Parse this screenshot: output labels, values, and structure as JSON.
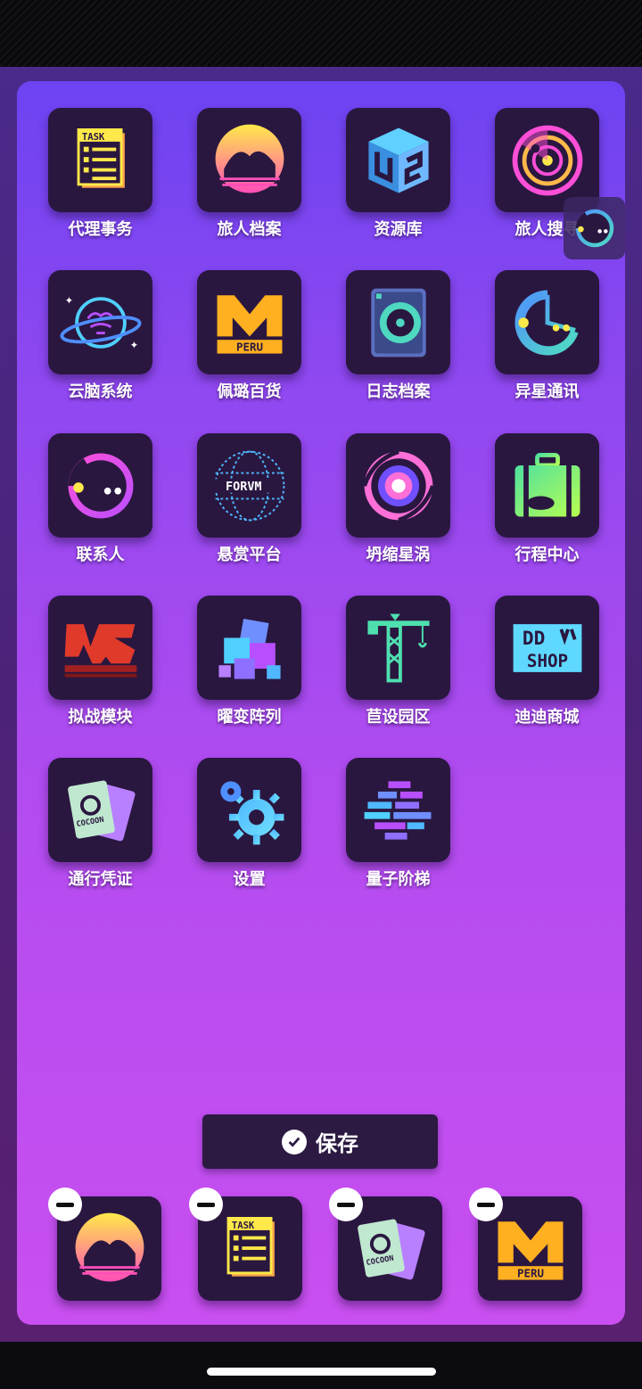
{
  "apps": [
    {
      "label": "代理事务",
      "icon": "task-list-icon"
    },
    {
      "label": "旅人档案",
      "icon": "leaper-archives-icon"
    },
    {
      "label": "资源库",
      "icon": "resource-cube-icon"
    },
    {
      "label": "旅人搜寻",
      "icon": "radar-icon"
    },
    {
      "label": "云脑系统",
      "icon": "cloud-brain-planet-icon"
    },
    {
      "label": "佩璐百货",
      "icon": "peru-logo-icon"
    },
    {
      "label": "日志档案",
      "icon": "disc-drive-icon"
    },
    {
      "label": "异星通讯",
      "icon": "chat-pacman-icon"
    },
    {
      "label": "联系人",
      "icon": "contacts-pacman-icon"
    },
    {
      "label": "悬赏平台",
      "icon": "forum-globe-icon"
    },
    {
      "label": "坍缩星涡",
      "icon": "vortex-icon"
    },
    {
      "label": "行程中心",
      "icon": "suitcase-icon"
    },
    {
      "label": "拟战模块",
      "icon": "vs-module-icon"
    },
    {
      "label": "曜变阵列",
      "icon": "cube-array-icon"
    },
    {
      "label": "苣设园区",
      "icon": "construction-crane-icon"
    },
    {
      "label": "迪迪商城",
      "icon": "dd-shop-icon"
    },
    {
      "label": "通行凭证",
      "icon": "cocoon-pass-icon"
    },
    {
      "label": "设置",
      "icon": "gear-icon"
    },
    {
      "label": "量子阶梯",
      "icon": "quantum-ladder-icon"
    }
  ],
  "floating": {
    "icon": "chat-pacman-icon"
  },
  "save_label": "保存",
  "dock": [
    {
      "icon": "leaper-archives-icon"
    },
    {
      "icon": "task-list-icon"
    },
    {
      "icon": "cocoon-pass-icon"
    },
    {
      "icon": "peru-logo-icon"
    }
  ],
  "colors": {
    "panel_top": "#6d43f2",
    "panel_bottom": "#c94ff0",
    "tile": "#2a1740"
  }
}
